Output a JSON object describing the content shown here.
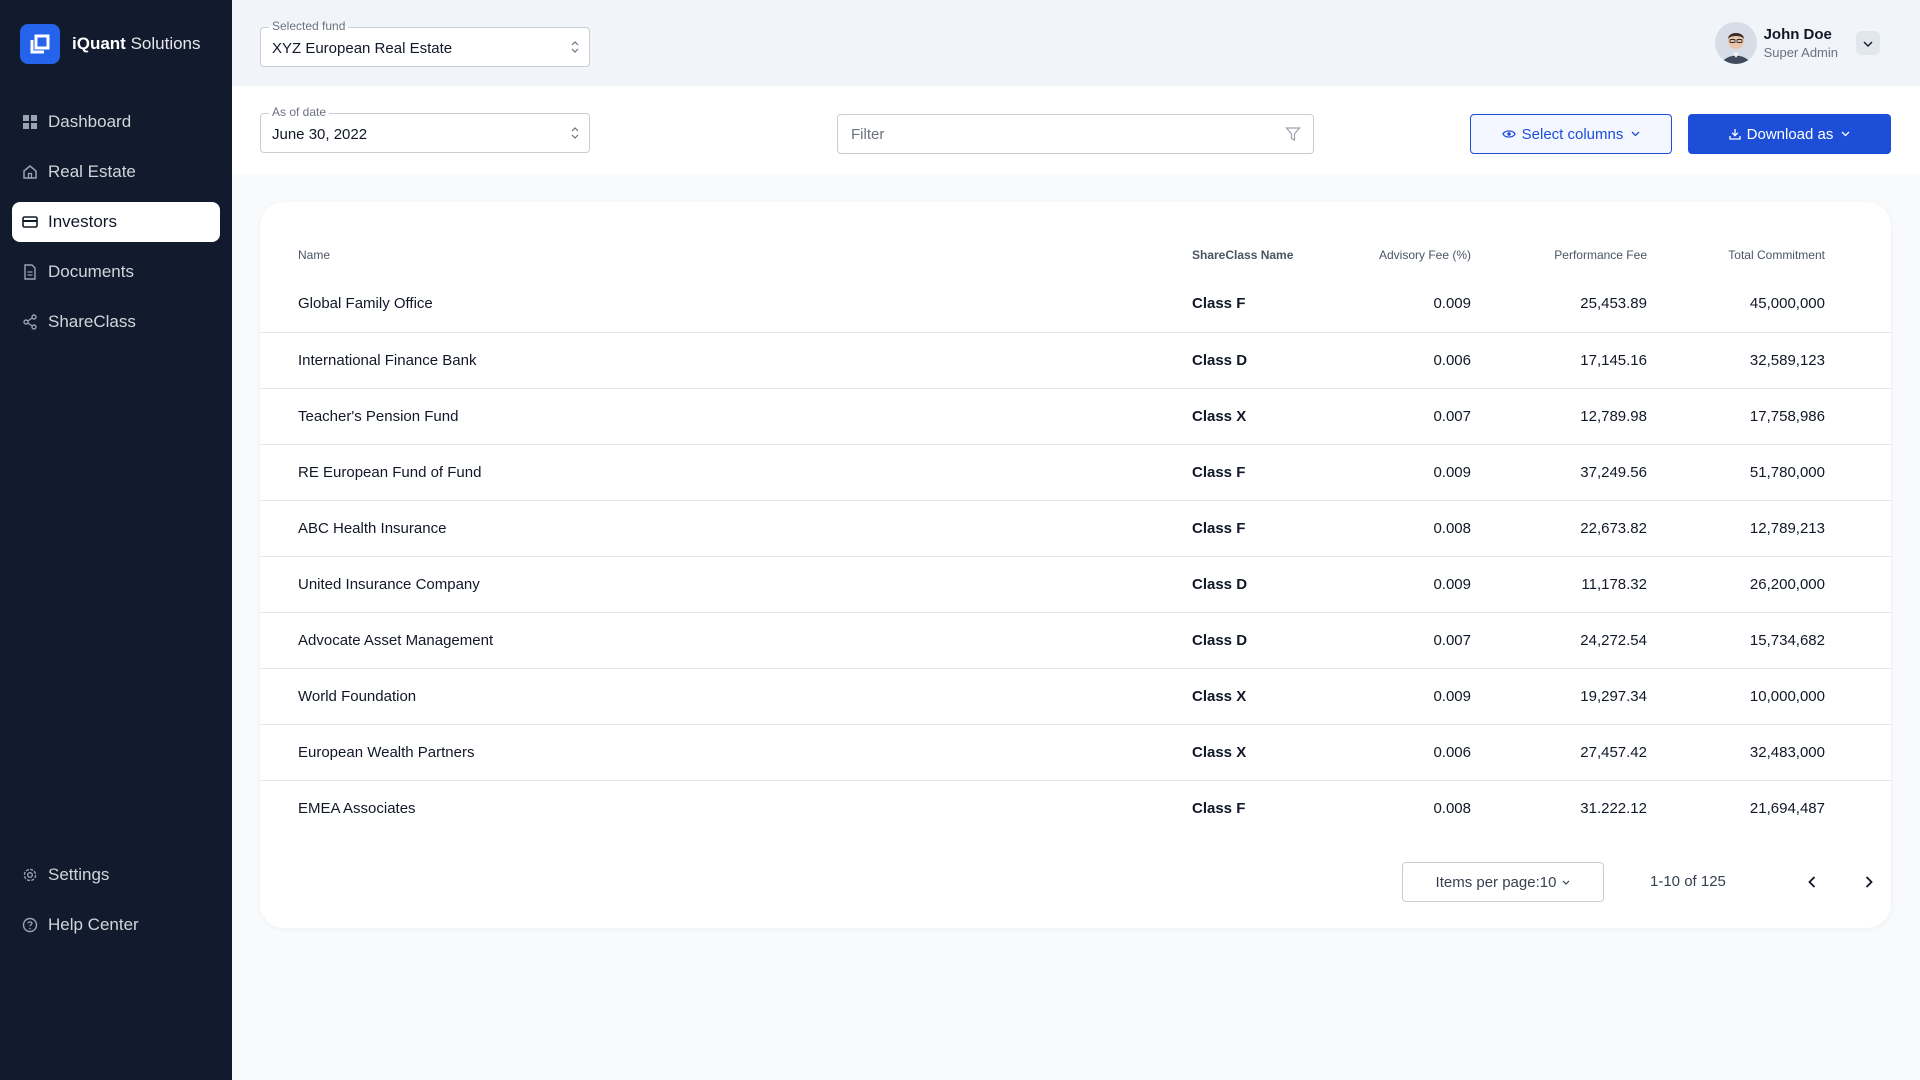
{
  "brand": {
    "name_bold": "iQuant",
    "name_light": "Solutions"
  },
  "sidebar": {
    "items": [
      {
        "label": "Dashboard",
        "icon": "grid-icon"
      },
      {
        "label": "Real Estate",
        "icon": "house-icon"
      },
      {
        "label": "Investors",
        "icon": "card-icon",
        "active": true
      },
      {
        "label": "Documents",
        "icon": "document-icon"
      },
      {
        "label": "ShareClass",
        "icon": "share-icon"
      }
    ],
    "bottom_items": [
      {
        "label": "Settings",
        "icon": "gear-icon"
      },
      {
        "label": "Help Center",
        "icon": "help-icon"
      }
    ]
  },
  "header": {
    "fund_label": "Selected fund",
    "fund_value": "XYZ European Real Estate",
    "user_name": "John Doe",
    "user_role": "Super Admin"
  },
  "toolbar": {
    "date_label": "As of date",
    "date_value": "June 30, 2022",
    "filter_placeholder": "Filter",
    "select_columns_label": "Select columns",
    "download_label": "Download as"
  },
  "table": {
    "columns": [
      "Name",
      "ShareClass Name",
      "Advisory Fee (%)",
      "Performance Fee",
      "Total Commitment"
    ],
    "rows": [
      [
        "Global Family Office",
        "Class F",
        "0.009",
        "25,453.89",
        "45,000,000"
      ],
      [
        "International Finance Bank",
        "Class D",
        "0.006",
        "17,145.16",
        "32,589,123"
      ],
      [
        "Teacher's Pension Fund",
        "Class X",
        "0.007",
        "12,789.98",
        "17,758,986"
      ],
      [
        "RE European Fund of Fund",
        "Class F",
        "0.009",
        "37,249.56",
        "51,780,000"
      ],
      [
        "ABC Health Insurance",
        "Class F",
        "0.008",
        "22,673.82",
        "12,789,213"
      ],
      [
        "United Insurance Company",
        "Class D",
        "0.009",
        "11,178.32",
        "26,200,000"
      ],
      [
        "Advocate Asset Management",
        "Class D",
        "0.007",
        "24,272.54",
        "15,734,682"
      ],
      [
        "World Foundation",
        "Class X",
        "0.009",
        "19,297.34",
        "10,000,000"
      ],
      [
        "European Wealth Partners",
        "Class X",
        "0.006",
        "27,457.42",
        "32,483,000"
      ],
      [
        "EMEA Associates",
        "Class F",
        "0.008",
        "31.222.12",
        "21,694,487"
      ]
    ]
  },
  "pagination": {
    "items_per_page": "Items per page:10",
    "range": "1-10 of 125"
  },
  "colors": {
    "sidebar_bg": "#111b2d",
    "accent": "#1d4ed8",
    "topbar_bg": "#f1f4f8"
  }
}
